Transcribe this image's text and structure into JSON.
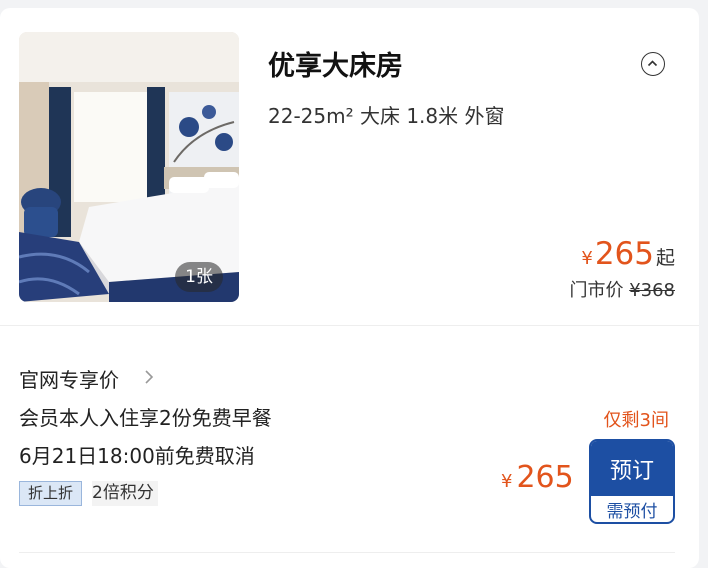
{
  "room": {
    "title": "优享大床房",
    "specs": "22-25m² 大床 1.8米 外窗",
    "photo_count": "1张",
    "price_currency": "¥",
    "price_amount": "265",
    "price_suffix": "起",
    "market_price_label": "门市价",
    "market_price_value": "¥368"
  },
  "plan": {
    "name": "官网专享价",
    "benefit": "会员本人入住享2份免费早餐",
    "cancellation": "6月21日18:00前免费取消",
    "discount_badge": "折上折",
    "points_badge": "2倍积分",
    "rooms_left": "仅剩3间",
    "price_currency": "¥",
    "price_amount": "265",
    "book_label": "预订",
    "prepay_label": "需预付"
  },
  "colors": {
    "price": "#e2541c",
    "primary": "#1d4fa3"
  },
  "icons": {
    "collapse": "chevron-up-circle-icon",
    "plan_arrow": "chevron-right-icon"
  }
}
